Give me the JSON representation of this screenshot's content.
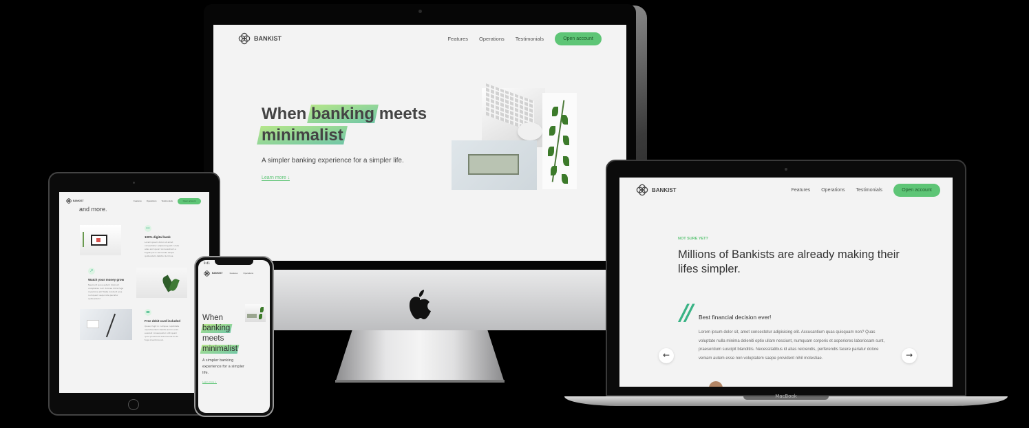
{
  "brand": {
    "name": "BANKIST",
    "accent": "#5ec576",
    "accent_dark": "#39b385"
  },
  "nav": {
    "links": [
      "Features",
      "Operations",
      "Testimonials"
    ],
    "cta": "Open account"
  },
  "hero": {
    "title_part1": "When",
    "title_hl1": "banking",
    "title_part2": "meets",
    "title_hl2": "minimalist",
    "subtitle": "A simpler banking experience for a simpler life.",
    "learn_more": "Learn more ↓"
  },
  "testimonials": {
    "tag": "NOT SURE YET?",
    "heading": "Millions of Bankists are already making their lifes simpler.",
    "quote_mark": "//",
    "title": "Best financial decision ever!",
    "text": "Lorem ipsum dolor sit, amet consectetur adipisicing elit. Accusantium quas quisquam non? Quas voluptate nulla minima deleniti optio ullam nesciunt, numquam corporis et asperiores laboriosam sunt, praesentium suscipit blanditiis. Necessitatibus id alias reiciendis, perferendis facere pariatur dolore veniam autem esse non voluptatem saepe provident nihil molestiae.",
    "prev": "←",
    "next": "→"
  },
  "tablet": {
    "heading_tail": "and more.",
    "features": [
      {
        "title": "100% digital bank",
        "text": "Lorem ipsum dolor sit amet consectetur adipisicing elit. Unde alias sint quos? Accusantium a fugiat porro reiciendis saepe quibusdam debitis ducimus."
      },
      {
        "title": "Watch your money grow",
        "text": "Nesciunt quos autem dolorum voluptates cum dolores dicta fuga inventore ab? Nulla incidunt eius numquam sequi iste pariatur quibusdam!"
      },
      {
        "title": "Free debit card included",
        "text": "Quasi, fugit in cumque cupiditate reprehenderit debitis animi enim eveniet consequatur odit quam quos possimus assumenda dicta fuga inventore ab."
      }
    ]
  },
  "phone": {
    "time": "9:41"
  },
  "laptop": {
    "label": "MacBook"
  }
}
